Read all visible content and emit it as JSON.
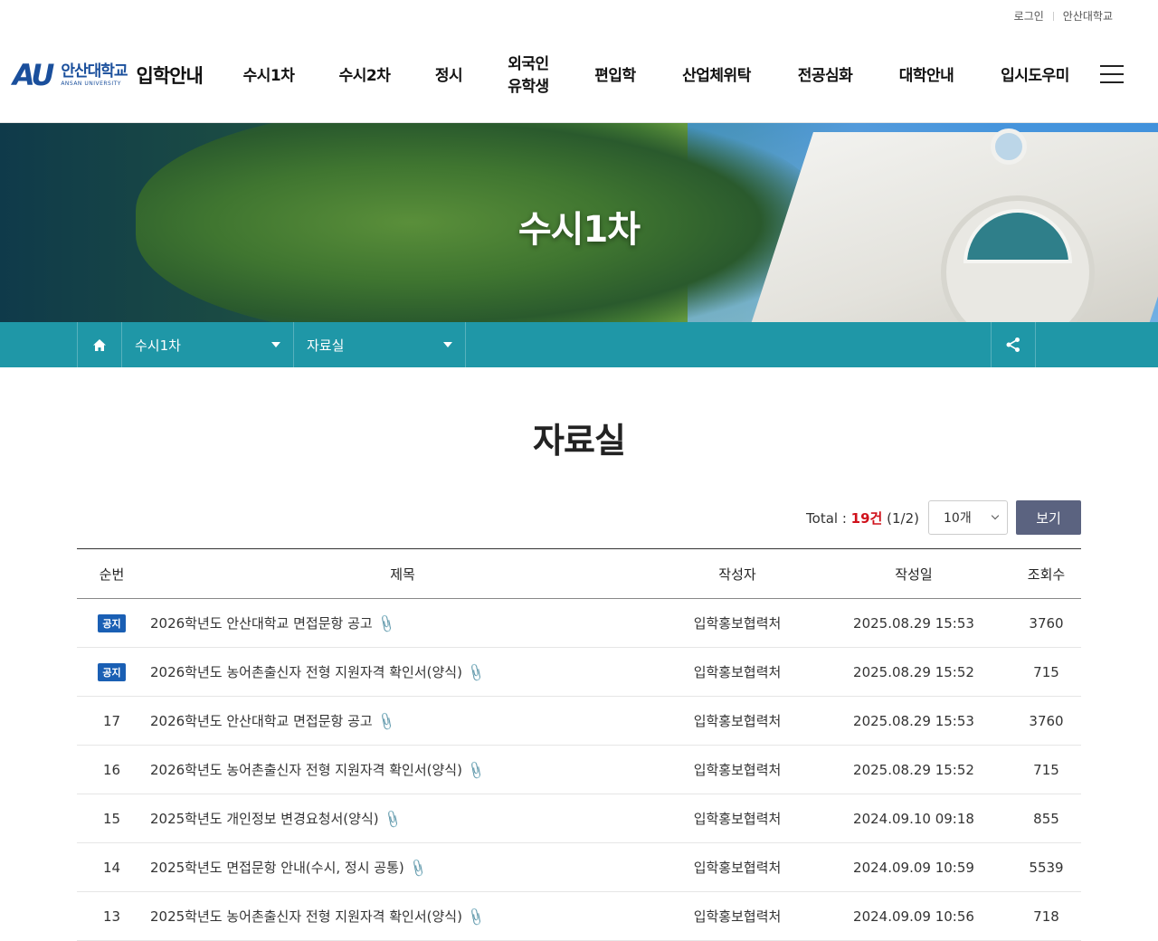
{
  "util": {
    "login": "로그인",
    "univ": "안산대학교"
  },
  "logo": {
    "mark": "AU",
    "ko": "안산대학교",
    "en": "ANSAN UNIVERSITY",
    "sub": "입학안내"
  },
  "gnb": [
    {
      "label": "수시1차"
    },
    {
      "label": "수시2차"
    },
    {
      "label": "정시"
    },
    {
      "label": "외국인\n유학생"
    },
    {
      "label": "편입학"
    },
    {
      "label": "산업체위탁"
    },
    {
      "label": "전공심화"
    },
    {
      "label": "대학안내"
    },
    {
      "label": "입시도우미"
    }
  ],
  "visual": {
    "title": "수시1차"
  },
  "location": {
    "depth1": "수시1차",
    "depth2": "자료실"
  },
  "page": {
    "title": "자료실"
  },
  "board_top": {
    "total_label": "Total :",
    "count": "19건",
    "pages": "(1/2)",
    "per_page": "10개",
    "view_button": "보기"
  },
  "table": {
    "headers": {
      "no": "순번",
      "title": "제목",
      "writer": "작성자",
      "date": "작성일",
      "views": "조회수"
    },
    "rows": [
      {
        "no": "공지",
        "notice": true,
        "title": "2026학년도 안산대학교 면접문항 공고",
        "writer": "입학홍보협력처",
        "date": "2025.08.29 15:53",
        "views": "3760"
      },
      {
        "no": "공지",
        "notice": true,
        "title": "2026학년도 농어촌출신자 전형 지원자격 확인서(양식)",
        "writer": "입학홍보협력처",
        "date": "2025.08.29 15:52",
        "views": "715"
      },
      {
        "no": "17",
        "notice": false,
        "title": "2026학년도 안산대학교 면접문항 공고",
        "writer": "입학홍보협력처",
        "date": "2025.08.29 15:53",
        "views": "3760"
      },
      {
        "no": "16",
        "notice": false,
        "title": "2026학년도 농어촌출신자 전형 지원자격 확인서(양식)",
        "writer": "입학홍보협력처",
        "date": "2025.08.29 15:52",
        "views": "715"
      },
      {
        "no": "15",
        "notice": false,
        "title": "2025학년도 개인정보 변경요청서(양식)",
        "writer": "입학홍보협력처",
        "date": "2024.09.10 09:18",
        "views": "855"
      },
      {
        "no": "14",
        "notice": false,
        "title": "2025학년도 면접문항 안내(수시, 정시 공통)",
        "writer": "입학홍보협력처",
        "date": "2024.09.09 10:59",
        "views": "5539"
      },
      {
        "no": "13",
        "notice": false,
        "title": "2025학년도 농어촌출신자 전형 지원자격 확인서(양식)",
        "writer": "입학홍보협력처",
        "date": "2024.09.09 10:56",
        "views": "718"
      }
    ]
  }
}
